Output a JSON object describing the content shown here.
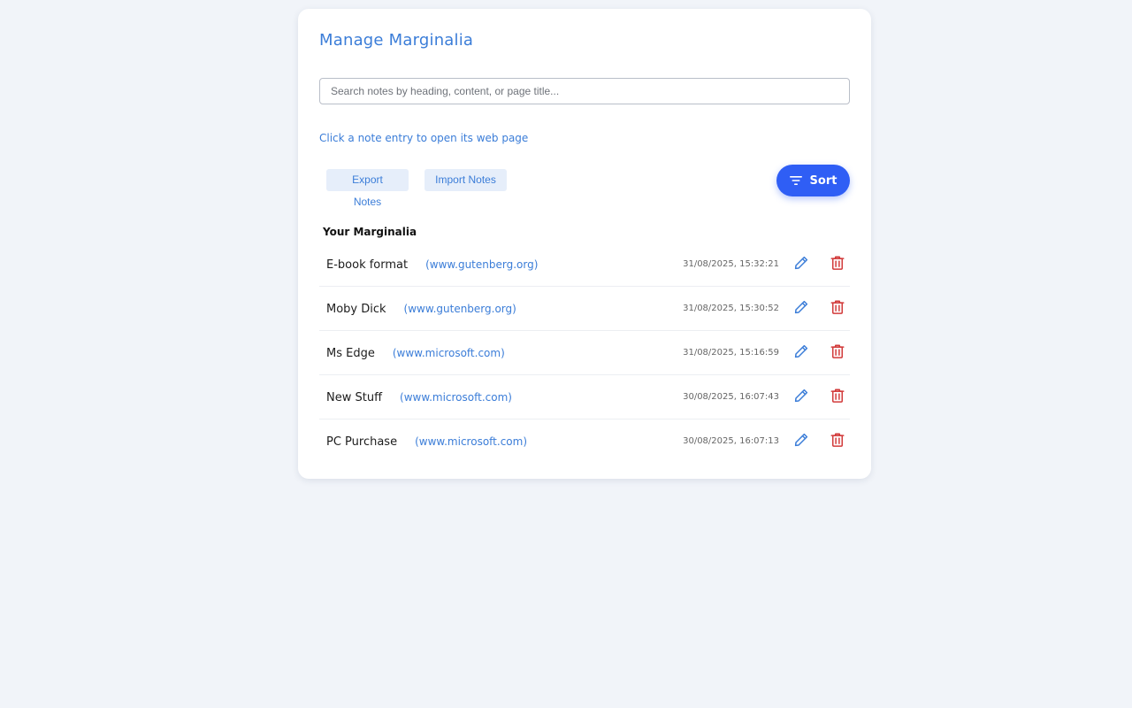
{
  "page": {
    "title": "Manage Marginalia"
  },
  "search": {
    "placeholder": "Search notes by heading, content, or page title...",
    "value": ""
  },
  "hint": "Click a note entry to open its web page",
  "toolbar": {
    "export_label": "Export Notes",
    "import_label": "Import Notes",
    "sort_label": "Sort",
    "sort_icon": "filter-icon"
  },
  "section_title": "Your Marginalia",
  "colors": {
    "accent": "#3b7dd8",
    "sort_button": "#2f5ef5",
    "delete": "#d23b3b",
    "background": "#f1f4f9"
  },
  "notes": [
    {
      "heading": "E-book format",
      "site": "(www.gutenberg.org)",
      "timestamp": "31/08/2025, 15:32:21",
      "edit_icon": "pencil-icon",
      "delete_icon": "trash-icon"
    },
    {
      "heading": "Moby Dick",
      "site": "(www.gutenberg.org)",
      "timestamp": "31/08/2025, 15:30:52",
      "edit_icon": "pencil-icon",
      "delete_icon": "trash-icon"
    },
    {
      "heading": "Ms Edge",
      "site": "(www.microsoft.com)",
      "timestamp": "31/08/2025, 15:16:59",
      "edit_icon": "pencil-icon",
      "delete_icon": "trash-icon"
    },
    {
      "heading": "New Stuff",
      "site": "(www.microsoft.com)",
      "timestamp": "30/08/2025, 16:07:43",
      "edit_icon": "pencil-icon",
      "delete_icon": "trash-icon"
    },
    {
      "heading": "PC Purchase",
      "site": "(www.microsoft.com)",
      "timestamp": "30/08/2025, 16:07:13",
      "edit_icon": "pencil-icon",
      "delete_icon": "trash-icon"
    }
  ]
}
